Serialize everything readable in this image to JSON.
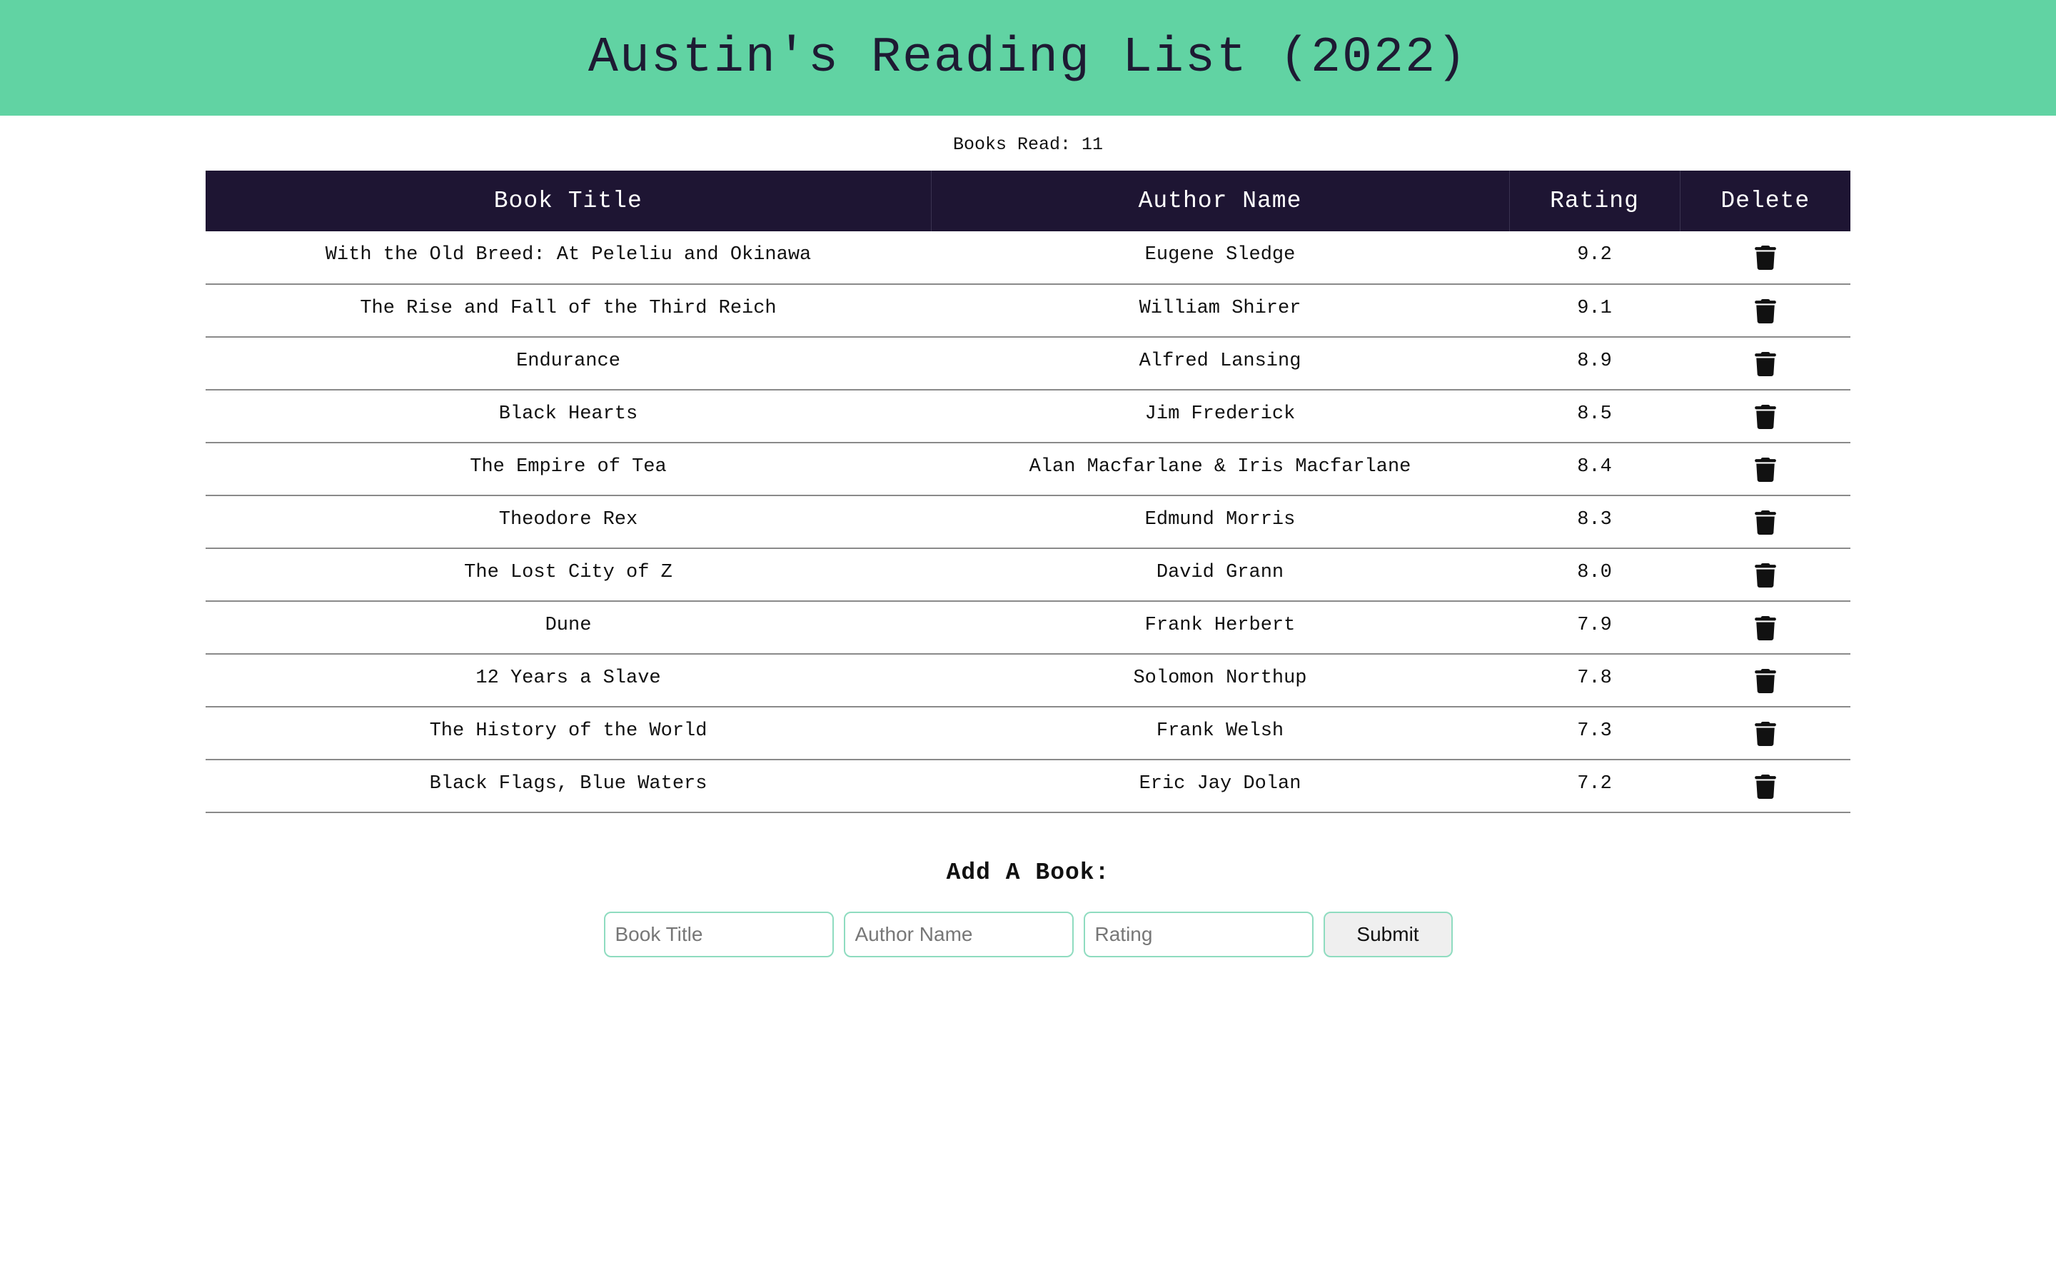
{
  "header": {
    "title": "Austin's Reading List (2022)"
  },
  "summary": {
    "books_read_text": "Books Read: 11"
  },
  "table": {
    "columns": [
      "Book Title",
      "Author Name",
      "Rating",
      "Delete"
    ],
    "rows": [
      {
        "title": "With the Old Breed: At Peleliu and Okinawa",
        "author": "Eugene Sledge",
        "rating": "9.2"
      },
      {
        "title": "The Rise and Fall of the Third Reich",
        "author": "William Shirer",
        "rating": "9.1"
      },
      {
        "title": "Endurance",
        "author": "Alfred Lansing",
        "rating": "8.9"
      },
      {
        "title": "Black Hearts",
        "author": "Jim Frederick",
        "rating": "8.5"
      },
      {
        "title": "The Empire of Tea",
        "author": "Alan Macfarlane & Iris Macfarlane",
        "rating": "8.4"
      },
      {
        "title": "Theodore Rex",
        "author": "Edmund Morris",
        "rating": "8.3"
      },
      {
        "title": "The Lost City of Z",
        "author": "David Grann",
        "rating": "8.0"
      },
      {
        "title": "Dune",
        "author": "Frank Herbert",
        "rating": "7.9"
      },
      {
        "title": "12 Years a Slave",
        "author": "Solomon Northup",
        "rating": "7.8"
      },
      {
        "title": "The History of the World",
        "author": "Frank Welsh",
        "rating": "7.3"
      },
      {
        "title": "Black Flags, Blue Waters",
        "author": "Eric Jay Dolan",
        "rating": "7.2"
      }
    ],
    "delete_icon": "trash-icon"
  },
  "add_form": {
    "title": "Add A Book:",
    "title_placeholder": "Book Title",
    "author_placeholder": "Author Name",
    "rating_placeholder": "Rating",
    "submit_label": "Submit"
  },
  "colors": {
    "header_bg": "#61d3a3",
    "table_header_bg": "#1e1533",
    "input_border": "#8fdcc0"
  }
}
